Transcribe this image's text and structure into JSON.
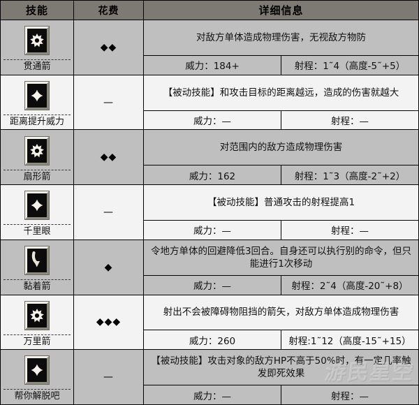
{
  "header": {
    "col_skill": "技能",
    "col_cost": "花费",
    "col_detail": "详细信息"
  },
  "labels": {
    "power_prefix": "威力：",
    "range_prefix": "射程：",
    "dash": "—"
  },
  "watermark": "游民星空",
  "colors": {
    "header_bg": "#7d7a73",
    "row_grey": "#bfbfbf",
    "row_white": "#f3f3f3",
    "border": "#000000",
    "icon_bg": "#0b0b0b"
  },
  "rows": [
    {
      "icon": "starburst-icon",
      "name": "贯通箭",
      "cost": "◆◆",
      "description": "对敌方单体造成物理伤害，无视敌方物防",
      "power": "威力：184+",
      "range": "射程：1˜4（高度-5˜+5）",
      "shade": "grey"
    },
    {
      "icon": "diamond-icon",
      "name": "距离提升威力",
      "cost": "—",
      "description": "【被动技能】和攻击目标的距离越远，造成的伤害就越大",
      "power": "威力：—",
      "range": "射程：—",
      "shade": "white"
    },
    {
      "icon": "starburst-icon",
      "name": "扇形箭",
      "cost": "◆◆",
      "description": "对范围内的敌方造成物理伤害",
      "power": "威力：162",
      "range": "射程：1˜3（高度-2˜+2）",
      "shade": "grey"
    },
    {
      "icon": "diamond-icon",
      "name": "千里眼",
      "cost": "—",
      "description": "【被动技能】普通攻击的射程提高1",
      "power": "威力：—",
      "range": "射程：—",
      "shade": "white"
    },
    {
      "icon": "curved-arrow-icon",
      "name": "黏着箭",
      "cost": "◆",
      "description": "令地方单体的回避降低3回合。自身还可以执行别的命令，但只能进行1次移动",
      "power": "威力：—",
      "range": "射程：2˜4（高度-20˜+8）",
      "shade": "grey"
    },
    {
      "icon": "starburst-icon",
      "name": "万里箭",
      "cost": "◆◆◆",
      "description": "射出不会被障碍物阻挡的箭矢，对敌方单体造成物理伤害",
      "power": "威力：260",
      "range": "射程:1˜12（高度-15˜+15）",
      "shade": "white"
    },
    {
      "icon": "diamond-icon",
      "name": "帮你解脱吧",
      "cost": "—",
      "description": "【被动技能】攻击对象的敌方HP不高于50%时，有一定几率触发即死效果",
      "power": "威力：—",
      "range": "射程：—",
      "shade": "grey"
    }
  ]
}
